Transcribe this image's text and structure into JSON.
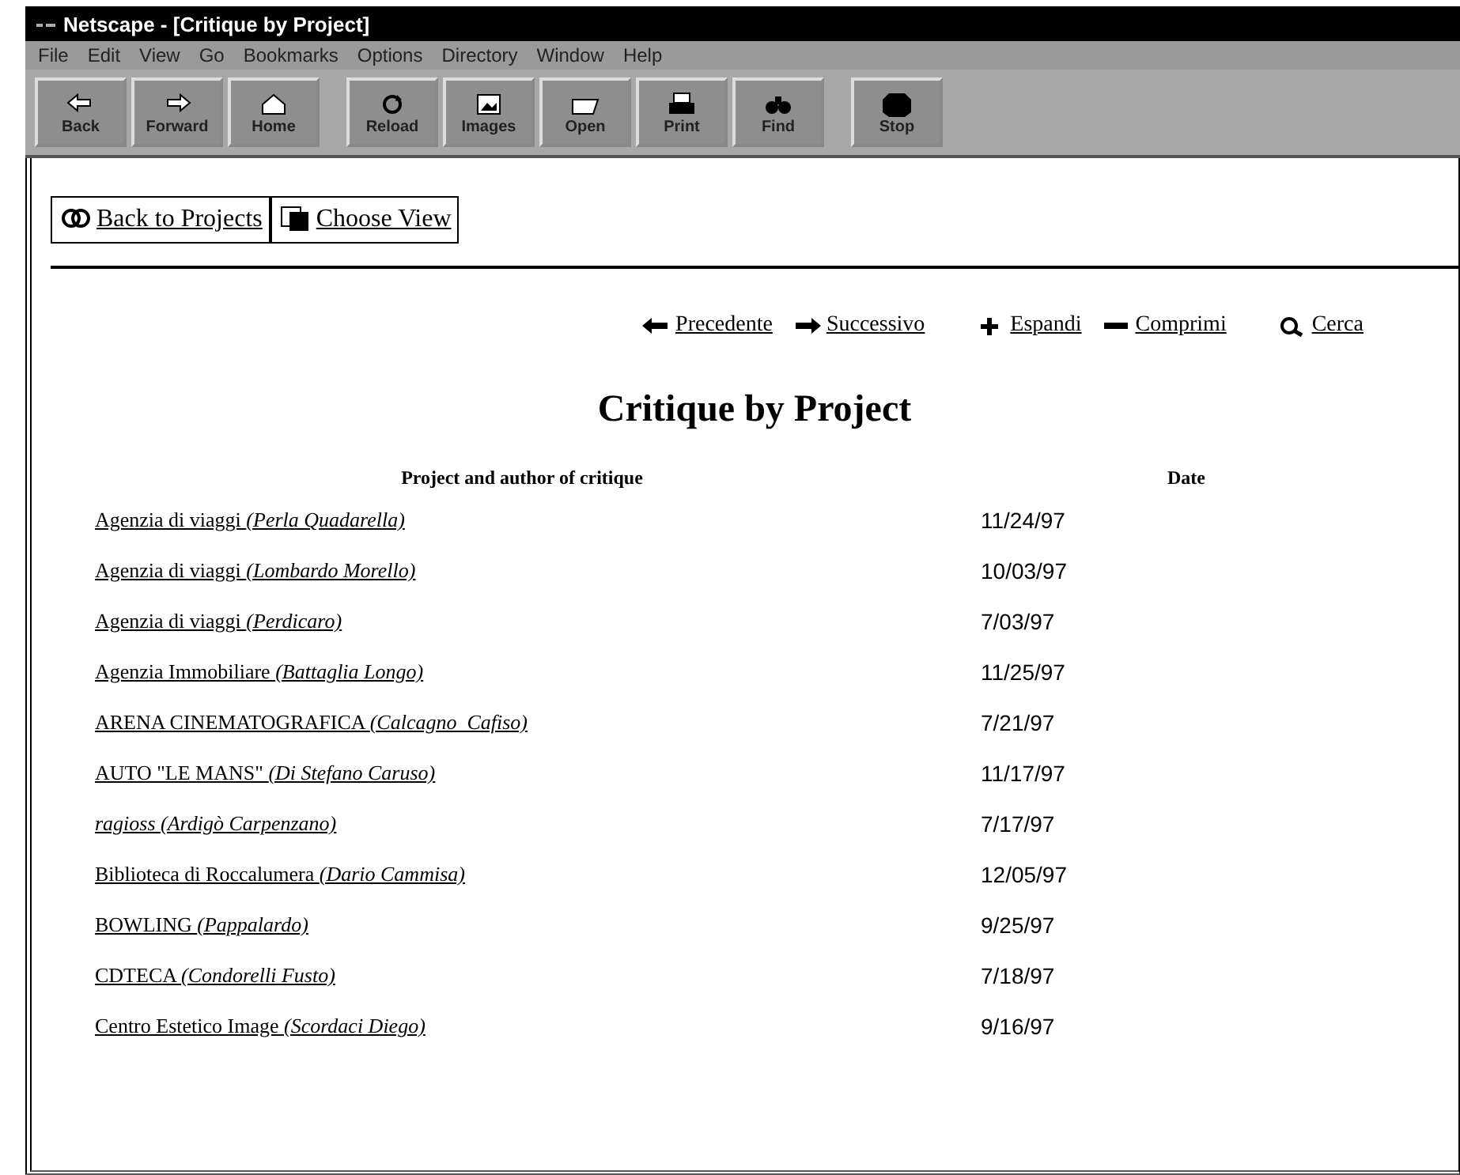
{
  "window": {
    "title": "Netscape - [Critique by Project]"
  },
  "menu": [
    "File",
    "Edit",
    "View",
    "Go",
    "Bookmarks",
    "Options",
    "Directory",
    "Window",
    "Help"
  ],
  "toolbar": [
    {
      "label": "Back"
    },
    {
      "label": "Forward"
    },
    {
      "label": "Home"
    },
    {
      "label": "Reload"
    },
    {
      "label": "Images"
    },
    {
      "label": "Open"
    },
    {
      "label": "Print"
    },
    {
      "label": "Find"
    },
    {
      "label": "Stop"
    }
  ],
  "page_buttons": [
    "Back to Projects",
    "Choose View"
  ],
  "nav_links": [
    "Precedente",
    "Successivo",
    "Espandi",
    "Comprimi",
    "Cerca"
  ],
  "heading": "Critique by Project",
  "table": {
    "columns": [
      "Project and author of critique",
      "Date"
    ],
    "rows": [
      {
        "project": "Agenzia di viaggi *(Perla Quadarella)*",
        "date": "11/24/97"
      },
      {
        "project": "Agenzia di viaggi *(Lombardo Morello)*",
        "date": "10/03/97"
      },
      {
        "project": "Agenzia di viaggi *(Perdicaro)*",
        "date": "7/03/97"
      },
      {
        "project": "Agenzia Immobiliare *(Battaglia Longo)*",
        "date": "11/25/97"
      },
      {
        "project": "ARENA CINEMATOGRAFICA *(Calcagno_Cafiso)*",
        "date": "7/21/97"
      },
      {
        "project": "AUTO \"LE MANS\" *(Di Stefano Caruso)*",
        "date": "11/17/97"
      },
      {
        "project": "*ragioss (Ardigò Carpenzano)*",
        "date": "7/17/97"
      },
      {
        "project": "Biblioteca di Roccalumera *(Dario Cammisa)*",
        "date": "12/05/97"
      },
      {
        "project": "BOWLING *(Pappalardo)*",
        "date": "9/25/97"
      },
      {
        "project": "CDTECA *(Condorelli Fusto)*",
        "date": "7/18/97"
      },
      {
        "project": "Centro Estetico Image *(Scordaci Diego)*",
        "date": "9/16/97"
      }
    ]
  }
}
